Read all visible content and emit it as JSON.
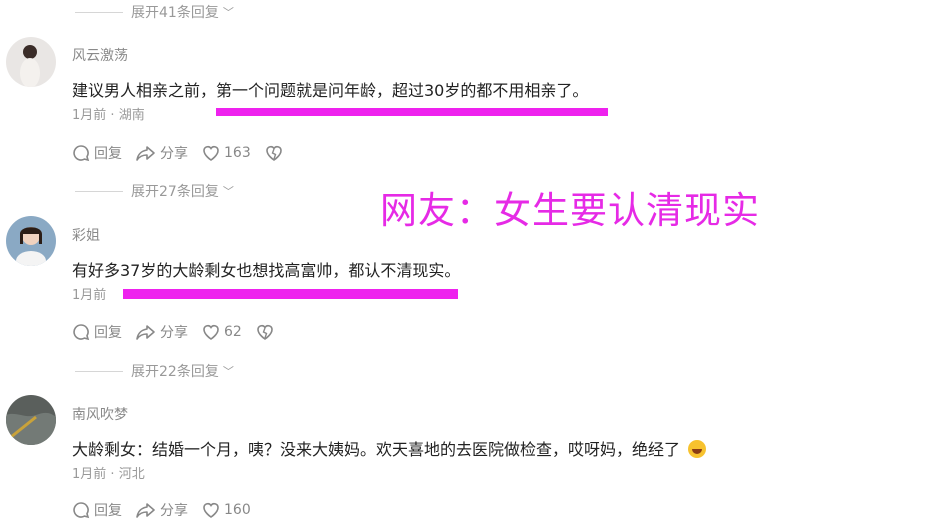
{
  "expand_labels": [
    "展开41条回复",
    "展开27条回复",
    "展开22条回复"
  ],
  "overlay_caption": "网友：女生要认清现实",
  "comments": [
    {
      "username": "风云激荡",
      "text": "建议男人相亲之前，第一个问题就是问年龄，超过30岁的都不用相亲了。",
      "time": "1月前",
      "location": "湖南",
      "reply_label": "回复",
      "share_label": "分享",
      "likes": "163"
    },
    {
      "username": "彩姐",
      "text": "有好多37岁的大龄剩女也想找高富帅，都认不清现实。",
      "time": "1月前",
      "location": "",
      "reply_label": "回复",
      "share_label": "分享",
      "likes": "62"
    },
    {
      "username": "南风吹梦",
      "text": "大龄剩女：结婚一个月，咦？没来大姨妈。欢天喜地的去医院做检查，哎呀妈，绝经了",
      "time": "1月前",
      "location": "河北",
      "reply_label": "回复",
      "share_label": "分享",
      "likes": "160"
    }
  ],
  "colors": {
    "highlight": "#ee22ee",
    "overlay_text": "#e62ae6"
  }
}
